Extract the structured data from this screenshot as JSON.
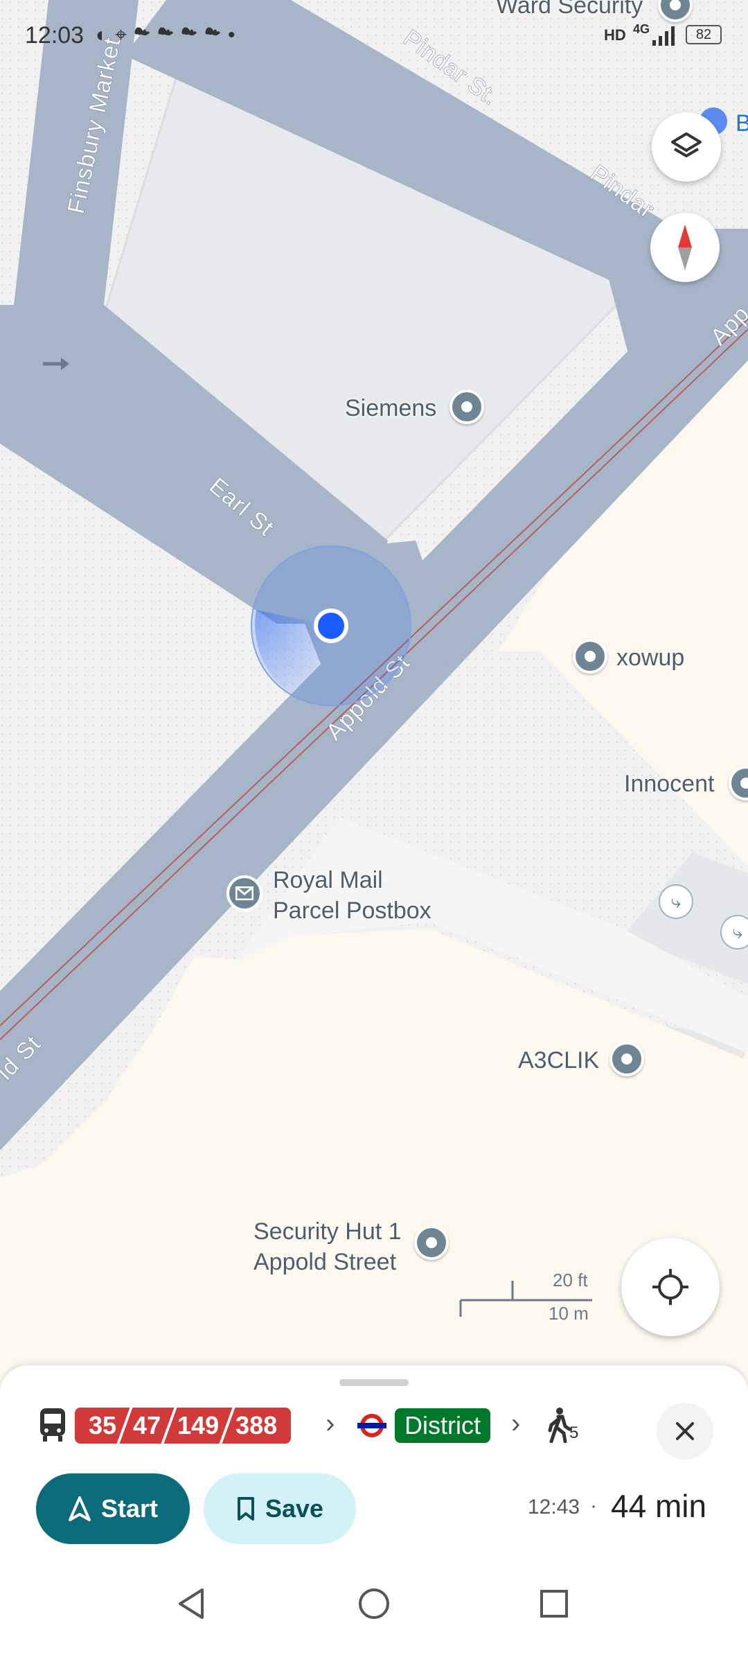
{
  "status_bar": {
    "time": "12:03",
    "network": "HD",
    "net_type": "4G",
    "battery": "82"
  },
  "map": {
    "streets": {
      "finsbury_market": "Finsbury Market",
      "pindar_st_1": "Pindar St.",
      "pindar_st_2": "Pindar",
      "appold_st_main": "Appold St",
      "appold_st_edge": "App",
      "appold_st_left": "ld St",
      "earl_st": "Earl St"
    },
    "pois": {
      "ward_security": "Ward Security",
      "siemens": "Siemens",
      "xowup": "xowup",
      "innocent": "Innocent",
      "royal_mail_line1": "Royal Mail",
      "royal_mail_line2": "Parcel Postbox",
      "a3clik": "A3CLIK",
      "security_hut_line1": "Security Hut 1",
      "security_hut_line2": "Appold Street",
      "edge_b": "B"
    },
    "scale": {
      "feet": "20 ft",
      "meters": "10 m"
    }
  },
  "route": {
    "bus_numbers": [
      "35",
      "47",
      "149",
      "388"
    ],
    "tube_line": "District",
    "walk_minutes": "5",
    "arrival_time": "12:43",
    "separator": "·",
    "duration": "44 min",
    "start_label": "Start",
    "save_label": "Save"
  },
  "icons": {
    "bus": "bus-icon",
    "underground": "underground-roundel-icon",
    "walk": "walking-person-icon",
    "close": "close-icon",
    "layers": "layers-icon",
    "compass": "compass-icon",
    "locate": "my-location-icon",
    "navigate": "navigation-arrow-icon",
    "bookmark": "bookmark-icon"
  },
  "colors": {
    "accent": "#0b6b7a",
    "bus": "#d23a3a",
    "district": "#00782a",
    "location_dot": "#1a5cff",
    "road": "#a7b5c8"
  }
}
